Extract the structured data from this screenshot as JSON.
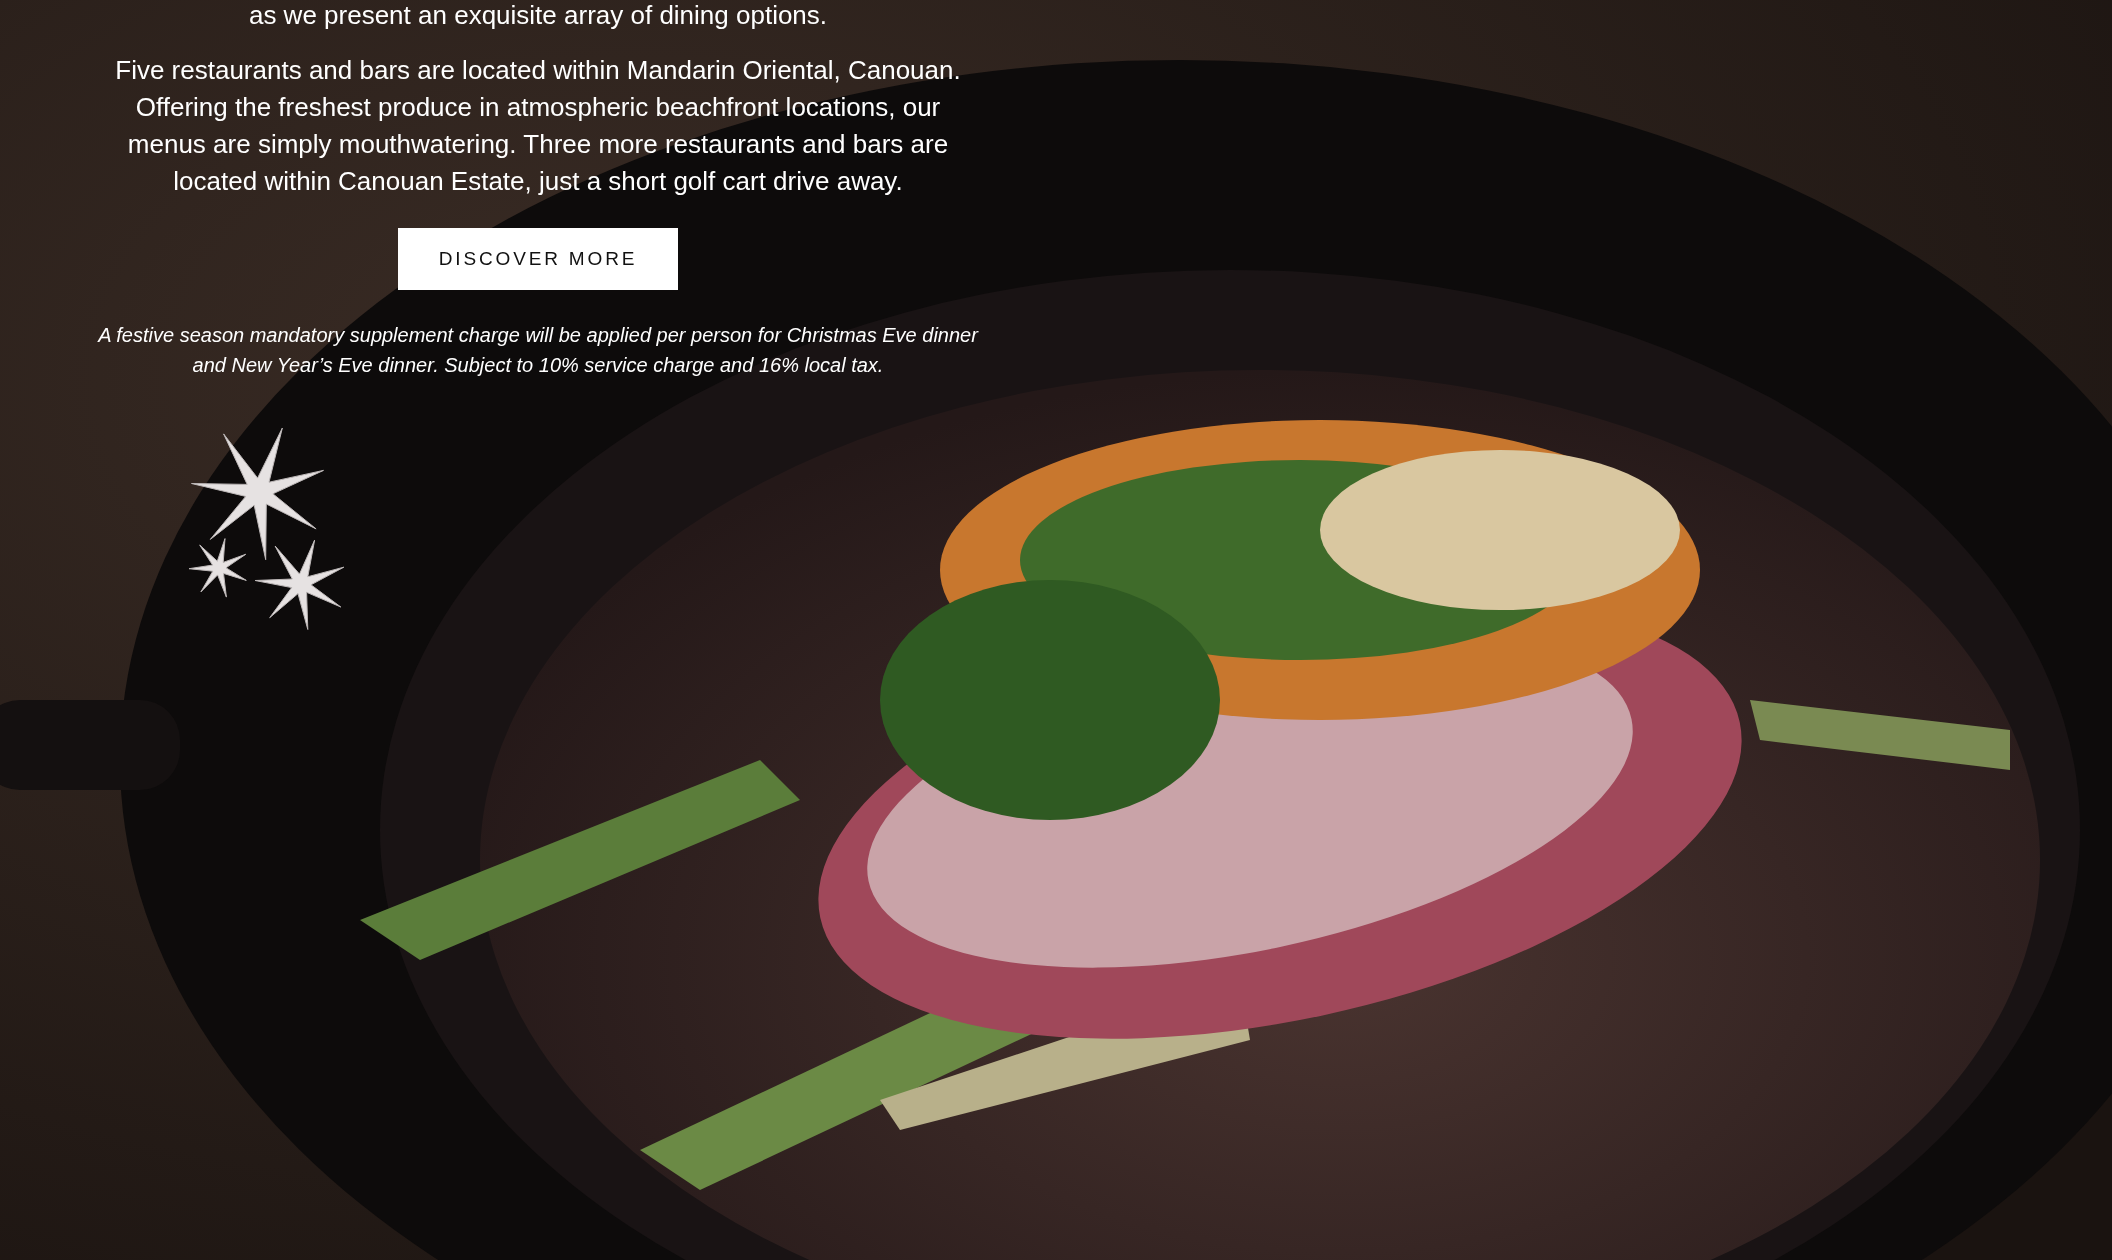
{
  "intro_line": "as we present an exquisite array of dining options.",
  "paragraph": "Five restaurants and bars are located within Mandarin Oriental, Canouan. Offering the freshest produce in atmospheric beachfront locations, our menus are simply mouthwatering. Three more restaurants and bars are located within Canouan Estate, just a short golf cart drive away.",
  "button": {
    "label": "DISCOVER MORE"
  },
  "note": "A festive season mandatory supplement charge will be applied per person for Christmas Eve dinner and New Year’s Eve dinner. Subject to 10% service charge and 16% local tax."
}
